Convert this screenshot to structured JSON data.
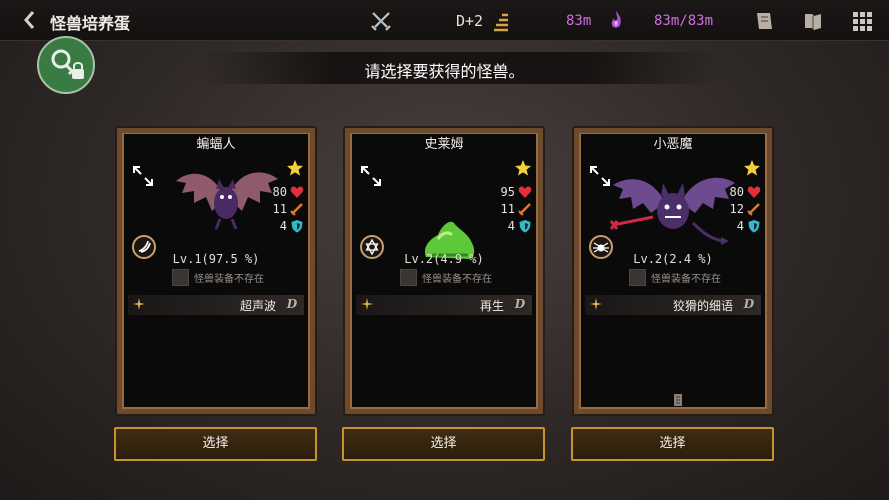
{
  "header": {
    "title": "怪兽培养蛋",
    "floor": "D+2",
    "mana_current": "83m",
    "mana_capacity": "83m/83m"
  },
  "prompt": "请选择要获得的怪兽。",
  "cards": [
    {
      "name": "蝙蝠人",
      "hp": "80",
      "attack": "11",
      "defense": "4",
      "level": "Lv.1(97.5 %)",
      "equipment": "怪兽装备不存在",
      "skill": "超声波",
      "grade": "D",
      "select": "选择"
    },
    {
      "name": "史莱姆",
      "hp": "95",
      "attack": "11",
      "defense": "4",
      "level": "Lv.2(4.9 %)",
      "equipment": "怪兽装备不存在",
      "skill": "再生",
      "grade": "D",
      "select": "选择"
    },
    {
      "name": "小恶魔",
      "hp": "80",
      "attack": "12",
      "defense": "4",
      "level": "Lv.2(2.4 %)",
      "equipment": "怪兽装备不存在",
      "skill": "狡猾的细语",
      "grade": "D",
      "select": "选择"
    }
  ],
  "icons": {
    "back": "chevron-left-icon",
    "battle": "crossed-swords-icon",
    "floor": "stairs-icon",
    "mana": "purple-flame-icon",
    "journal": "journal-icon",
    "book": "book-icon",
    "menu": "grid-menu-icon",
    "key": "key-lock-icon"
  },
  "colors": {
    "mana": "#cf6fe0",
    "button_border": "#c8922d",
    "card_frame": "#9a6a3c",
    "heart": "#e0313a",
    "shield": "#38b7c4",
    "star": "#f4cf3a"
  }
}
